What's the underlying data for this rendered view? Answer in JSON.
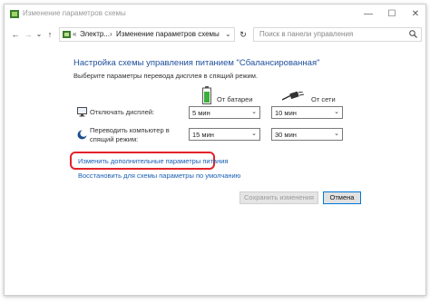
{
  "window": {
    "title": "Изменение параметров схемы",
    "controls": {
      "minimize": "—",
      "maximize": "☐",
      "close": "✕"
    }
  },
  "addressbar": {
    "back": "←",
    "forward": "→",
    "dropdown": "⌄",
    "up": "↑",
    "path_overflow": "«",
    "crumbs": [
      "Электр...",
      "Изменение параметров схемы"
    ],
    "crumb_sep": "›",
    "path_chevron": "⌄",
    "refresh": "↻",
    "search_placeholder": "Поиск в панели управления"
  },
  "main": {
    "heading": "Настройка схемы управления питанием \"Сбалансированная\"",
    "subheading": "Выберите параметры перевода дисплея в спящий режим.",
    "columns": {
      "battery": "От батареи",
      "power": "От сети"
    },
    "rows": [
      {
        "label": "Отключать дисплей:",
        "battery": "5 мин",
        "power": "10 мин",
        "icon": "display-icon"
      },
      {
        "label": "Переводить компьютер в спящий режим:",
        "battery": "15 мин",
        "power": "30 мин",
        "icon": "moon-icon"
      }
    ],
    "links": {
      "advanced": "Изменить дополнительные параметры питания",
      "restore": "Восстановить для схемы параметры по умолчанию"
    },
    "buttons": {
      "save": "Сохранить изменения",
      "cancel": "Отмена"
    }
  },
  "colors": {
    "heading": "#1e4f9c",
    "link": "#1a5fb4",
    "highlight": "#e3222a"
  }
}
